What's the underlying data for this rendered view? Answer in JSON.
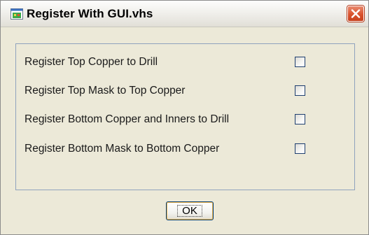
{
  "window": {
    "title": "Register With GUI.vhs",
    "icon": "app-window-icon",
    "close_icon": "close-icon"
  },
  "options": [
    {
      "label": "Register Top Copper to Drill",
      "checked": false
    },
    {
      "label": "Register Top Mask to Top Copper",
      "checked": false
    },
    {
      "label": "Register Bottom Copper and Inners to Drill",
      "checked": false
    },
    {
      "label": "Register Bottom Mask to Bottom Copper",
      "checked": false
    }
  ],
  "buttons": {
    "ok_label": "OK"
  },
  "colors": {
    "window_bg": "#ece9d8",
    "close_button": "#d9532e",
    "group_border": "#8fa2bd",
    "button_border": "#003c74"
  }
}
